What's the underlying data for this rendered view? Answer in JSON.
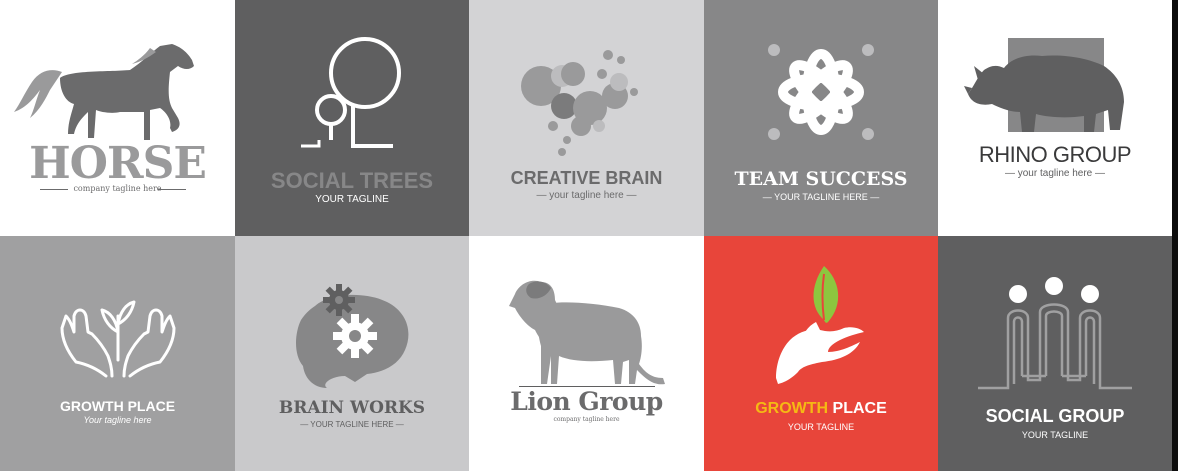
{
  "tiles": [
    {
      "name": "HORSE",
      "tagline": "company tagline here"
    },
    {
      "name": "SOCIAL TREES",
      "tagline": "YOUR TAGLINE"
    },
    {
      "name": "CREATIVE BRAIN",
      "tagline": "— your tagline here —"
    },
    {
      "name": "TEAM SUCCESS",
      "tagline": "— YOUR TAGLINE HERE —"
    },
    {
      "name": "RHINO GROUP",
      "tagline": "— your tagline here —"
    },
    {
      "name": "GROWTH PLACE",
      "tagline": "Your tagline here"
    },
    {
      "name": "BRAIN WORKS",
      "tagline": "— YOUR TAGLINE HERE —"
    },
    {
      "name": "Lion Group",
      "tagline": "company tagline here"
    },
    {
      "name_part1": "GROWTH",
      "name_part2": "PLACE",
      "tagline": "YOUR TAGLINE"
    },
    {
      "name": "SOCIAL GROUP",
      "tagline": "YOUR TAGLINE"
    }
  ],
  "colors": {
    "white": "#ffffff",
    "dark_gray": "#5f5f60",
    "light_gray": "#d3d3d5",
    "mid_gray": "#878788",
    "pale_gray": "#bcbcbe",
    "red": "#e8453a",
    "yellow": "#f5b914",
    "leaf_green": "#8dc63f"
  },
  "icons": [
    "horse-icon",
    "tree-icon",
    "brain-bubbles-icon",
    "team-x-icon",
    "rhino-icon",
    "hands-sprout-icon",
    "brain-gears-icon",
    "lion-icon",
    "hand-leaf-icon",
    "people-pillars-icon"
  ]
}
